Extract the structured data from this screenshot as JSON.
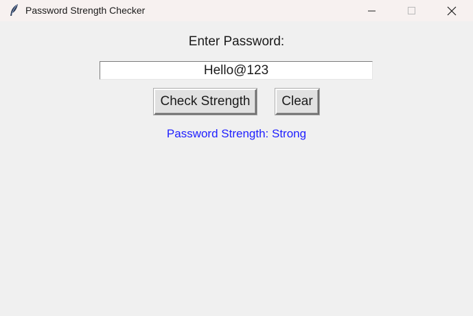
{
  "window": {
    "title": "Password Strength Checker",
    "icon": "feather-icon"
  },
  "form": {
    "prompt_label": "Enter Password:",
    "password_value": "Hello@123",
    "check_button_label": "Check Strength",
    "clear_button_label": "Clear"
  },
  "result": {
    "text": "Password Strength: Strong",
    "color": "#2020ff"
  },
  "colors": {
    "background": "#f0f0f0",
    "titlebar": "#f7f1f0"
  }
}
